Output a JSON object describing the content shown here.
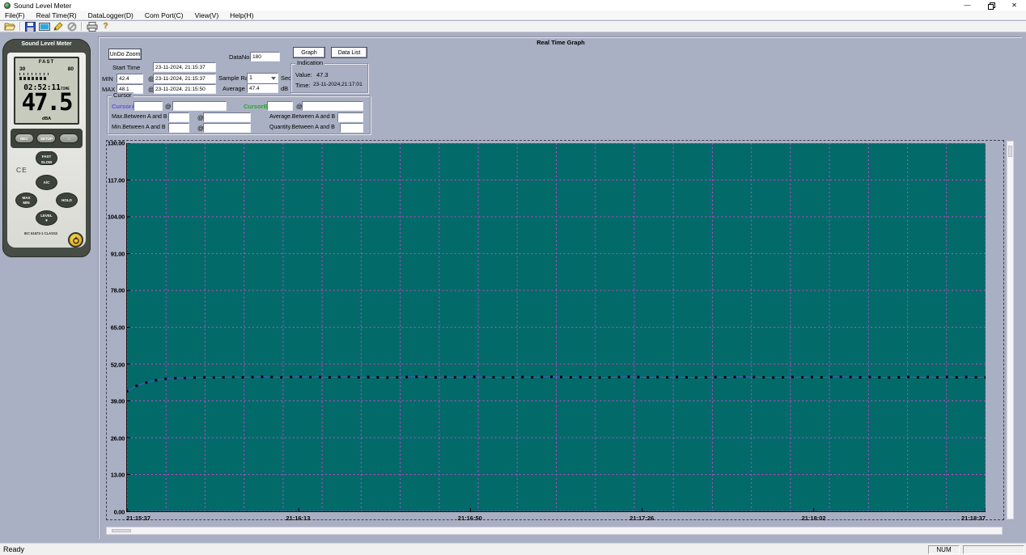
{
  "window": {
    "title": "Sound Level Meter",
    "minimize_glyph": "—",
    "close_glyph": "✕"
  },
  "menu": {
    "items": [
      "File(F)",
      "Real Time(R)",
      "DataLogger(D)",
      "Com Port(C)",
      "View(V)",
      "Help(H)"
    ]
  },
  "toolbar": {
    "icons": [
      "open-folder",
      "save",
      "window",
      "pen",
      "stop",
      "printer",
      "help"
    ],
    "help_glyph": "?"
  },
  "device": {
    "title": "Sound Level Meter",
    "lcd_mode": "FAST",
    "lcd_scale_left": "30",
    "lcd_scale_right": "80",
    "lcd_time": "02:52:11",
    "lcd_time_unit": "TIME",
    "lcd_value": "47.5",
    "lcd_unit": "dBA",
    "btn_rec": "REC",
    "btn_setup": "SETUP",
    "btn_light": "☼",
    "btn_fast": "FAST",
    "btn_slow": "SLOW",
    "btn_ac": "A/C",
    "btn_max": "MAX",
    "btn_min": "MIN",
    "btn_hold": "HOLD",
    "btn_level": "LEVEL",
    "btn_level_arrow": "▼",
    "ce": "CE",
    "cert": "IEC 61672-1 CLASS2"
  },
  "panel": {
    "title": "Real Time Graph",
    "undo_zoom": "UnDo Zoom",
    "graph": "Graph",
    "data_list": "Data List",
    "datano_label": "DataNo.",
    "datano": "180",
    "start_time_label": "Start Time",
    "start_time": "23-11-2024, 21:15:37",
    "min_label": "MIN",
    "min_value": "42.4",
    "min_time": "23-11-2024, 21:15:37",
    "max_label": "MAX",
    "max_value": "48.1",
    "max_time": "23-11-2024, 21:15:50",
    "at": "@",
    "sample_rate_label": "Sample Rate",
    "sample_rate": "1",
    "sample_rate_unit": "Sec",
    "average_label": "Average",
    "average": "47.4",
    "average_unit": "dB",
    "indication": {
      "title": "Indication",
      "value_label": "Value:",
      "value": "47.3",
      "time_label": "Time:",
      "time": "23-11-2024,21:17:01"
    },
    "cursor": {
      "title": "Cursor",
      "a_label": "CursorA",
      "b_label": "CursorB",
      "a_color": "#6655cc",
      "b_color": "#2ba52b",
      "max_between_label": "Max.Between A and B",
      "min_between_label": "Min.Between A and B",
      "avg_between_label": "Average.Between A and B",
      "qty_between_label": "Quantity.Between A and B"
    }
  },
  "statusbar": {
    "ready": "Ready",
    "num": "NUM"
  },
  "chart_data": {
    "type": "line",
    "title": "Real Time Graph",
    "ylabel": "dB",
    "ylim": [
      0,
      130
    ],
    "y_ticks": [
      "130.00",
      "117.00",
      "104.00",
      "91.00",
      "78.00",
      "65.00",
      "52.00",
      "39.00",
      "26.00",
      "13.00",
      "0.00"
    ],
    "x_ticks": [
      "21:15:37",
      "21:16:13",
      "21:16:50",
      "21:17:26",
      "21:18:02",
      "21:18:37"
    ],
    "x_grid_divisions": 22,
    "grid": true,
    "colors": {
      "plot_bg": "#036a6a",
      "grid": "#cc44cc",
      "line": "#3d5fc0",
      "marker": "#000000"
    },
    "values": [
      42.4,
      44.3,
      45.5,
      46.3,
      46.8,
      47.0,
      47.1,
      47.2,
      47.3,
      47.2,
      47.3,
      47.4,
      47.3,
      47.4,
      47.5,
      47.4,
      47.3,
      47.4,
      47.5,
      47.4,
      47.4,
      47.3,
      47.4,
      47.5,
      47.3,
      47.4,
      47.3,
      47.2,
      47.3,
      47.4,
      47.5,
      47.4,
      47.3,
      47.4,
      47.3,
      47.4,
      47.5,
      47.4,
      47.3,
      47.2,
      47.3,
      47.4,
      47.3,
      47.4,
      47.5,
      47.4,
      47.3,
      47.4,
      47.3,
      47.2,
      47.3,
      47.4,
      47.5,
      47.4,
      47.3,
      47.4,
      47.3,
      47.4,
      47.3,
      47.2,
      47.3,
      47.4,
      47.3,
      47.4,
      47.5,
      47.4,
      47.3,
      47.2,
      47.3,
      47.4,
      47.3,
      47.4,
      47.3,
      47.4,
      47.5,
      47.4,
      47.3,
      47.4,
      47.3,
      47.2,
      47.3,
      47.4,
      47.3,
      47.4,
      47.3,
      47.4,
      47.3,
      47.4,
      47.3,
      47.3
    ]
  }
}
